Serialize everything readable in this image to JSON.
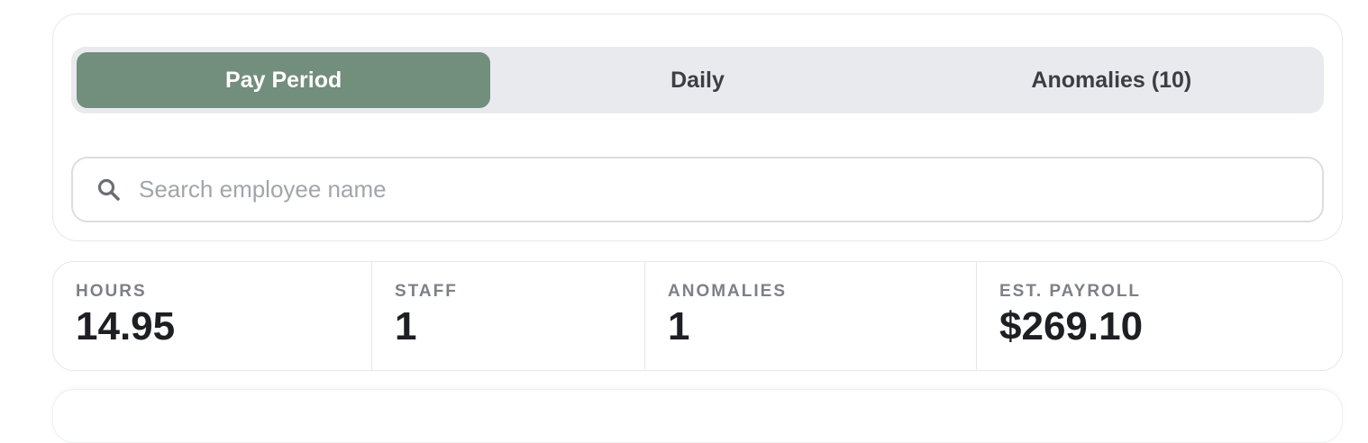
{
  "tabs": [
    {
      "label": "Pay Period",
      "active": true
    },
    {
      "label": "Daily",
      "active": false
    },
    {
      "label": "Anomalies (10)",
      "active": false
    }
  ],
  "search": {
    "placeholder": "Search employee name",
    "value": "",
    "icon": "search-icon"
  },
  "stats": {
    "hours": {
      "label": "HOURS",
      "value": "14.95"
    },
    "staff": {
      "label": "STAFF",
      "value": "1"
    },
    "anomalies": {
      "label": "ANOMALIES",
      "value": "1"
    },
    "payroll": {
      "label": "EST. PAYROLL",
      "value": "$269.10"
    }
  },
  "colors": {
    "accent": "#728e7d",
    "segment_bg": "#e9eaed",
    "border": "#e6e7ea",
    "text_primary": "#1d1f23",
    "text_muted": "#7d8088"
  }
}
